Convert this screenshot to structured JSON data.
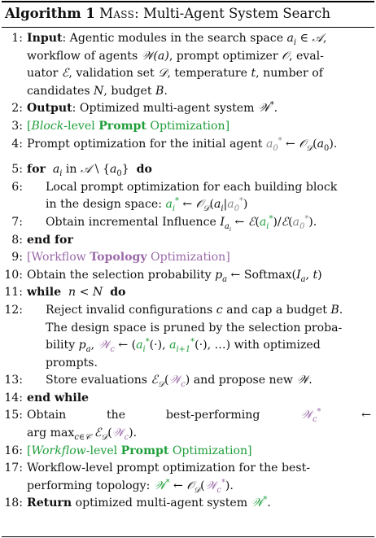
{
  "header": {
    "algorithm_label": "Algorithm 1",
    "name": "Mass",
    "title_rest": ": Multi-Agent System Search"
  },
  "lines": {
    "n1": "1:",
    "n2": "2:",
    "n3": "3:",
    "n4": "4:",
    "n5": "5:",
    "n6": "6:",
    "n7": "7:",
    "n8": "8:",
    "n9": "9:",
    "n10": "10:",
    "n11": "11:",
    "n12": "12:",
    "n13": "13:",
    "n14": "14:",
    "n15": "15:",
    "n16": "16:",
    "n17": "17:",
    "n18": "18:"
  },
  "text": {
    "input_kw": "Input",
    "input_a": ": Agentic modules in the search space ",
    "input_b": "workflow of agents ",
    "input_c": ", prompt optimizer ",
    "input_d": ", eval-",
    "input_e": "uator ",
    "input_f": ", validation set ",
    "input_g": ", temperature ",
    "input_h": ", number of",
    "input_i": "candidates ",
    "input_j": ", budget ",
    "output_kw": "Output",
    "output_a": ": Optimized multi-agent system ",
    "l3_block": "Block",
    "l3_level": "-level ",
    "l3_prompt": "Prompt",
    "l3_opt": " Optimization]",
    "l4": "Prompt optimization for the initial agent ",
    "for_kw": "for",
    "in_kw": "in",
    "do_kw": "do",
    "l6a": "Local prompt optimization for each building block",
    "l6b": "in the design space: ",
    "l7": "Obtain incremental Influence ",
    "endfor_kw": "end for",
    "l9_workflow": "[Workflow ",
    "l9_topology": "Topology",
    "l9_opt": " Optimization]",
    "l10": "Obtain the selection probability ",
    "while_kw": "while",
    "l12a": "Reject invalid configurations ",
    "l12b": " and cap a budget ",
    "l12c": "The design space is pruned by the selection proba-",
    "l12d": "bility ",
    "l12e": " with optimized",
    "l12f": "prompts.",
    "l13a": "Store evaluations ",
    "l13b": " and propose new ",
    "endwhile_kw": "end while",
    "l15a": "Obtain",
    "l15b": "the",
    "l15c": "best-performing",
    "l16_workflow": "Workflow",
    "l16_level": "-level ",
    "l16_prompt": "Prompt",
    "l16_opt": " Optimization]",
    "l17a": "Workflow-level prompt optimization for the best-",
    "l17b": "performing topology: ",
    "return_kw": "Return",
    "l18": " optimized multi-agent system "
  },
  "colors": {
    "green": "#1f9e3a",
    "purple": "#9b6aa8"
  }
}
